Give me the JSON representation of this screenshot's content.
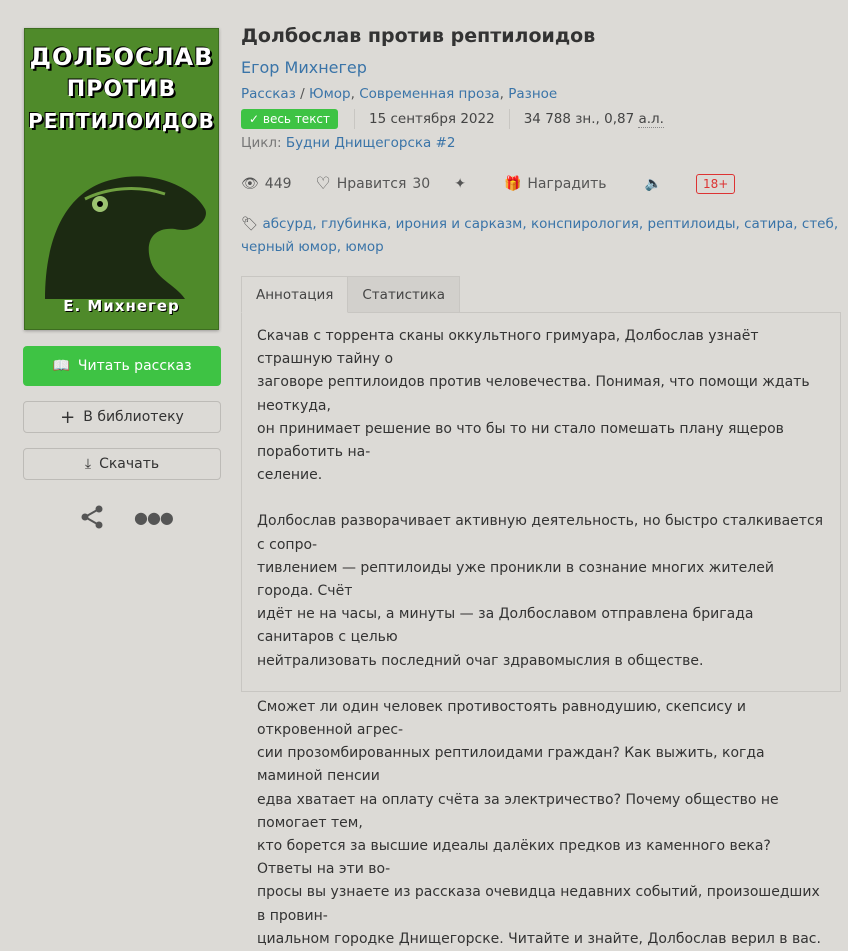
{
  "cover": {
    "title_lines": [
      "ДОЛБОСЛАВ",
      "ПРОТИВ",
      "РЕПТИЛОИДОВ"
    ],
    "author": "Е. Михнегер"
  },
  "sidebar": {
    "read_label": "Читать рассказ",
    "library_label": "В библиотеку",
    "download_label": "Скачать"
  },
  "book": {
    "title": "Долбослав против рептилоидов",
    "author": "Егор Михнегер",
    "genres": [
      {
        "label": "Рассказ"
      },
      {
        "label": "Юмор"
      },
      {
        "label": "Современная проза"
      },
      {
        "label": "Разное"
      }
    ],
    "badge": "весь текст",
    "date": "15 сентября 2022",
    "size": "34 788 зн., 0,87",
    "size_unit": "а.л.",
    "cycle_label": "Цикл:",
    "cycle": "Будни Днищегорска #2"
  },
  "stats": {
    "views": "449",
    "likes_label": "Нравится",
    "likes": "30",
    "reward_label": "Наградить",
    "age": "18+"
  },
  "tags": [
    "абсурд",
    "глубинка",
    "ирония и сарказм",
    "конспирология",
    "рептилоиды",
    "сатира",
    "стеб",
    "черный юмор",
    "юмор"
  ],
  "tabs": [
    "Аннотация",
    "Статистика"
  ],
  "annotation": [
    [
      "Скачав с торрента сканы оккультного гримуара, Долбослав узнаёт страшную тайну о",
      "заговоре рептилоидов против человечества. Понимая, что помощи ждать неоткуда,",
      "он принимает решение во что бы то ни стало помешать плану ящеров поработить на-",
      "селение."
    ],
    [
      "Долбослав разворачивает активную деятельность, но быстро сталкивается с сопро-",
      "тивлением — рептилоиды уже проникли в сознание многих жителей города. Счёт",
      "идёт не на часы, а минуты — за Долбославом отправлена бригада санитаров с целью",
      "нейтрализовать последний очаг здравомыслия в обществе."
    ],
    [
      "Сможет ли один человек противостоять равнодушию, скепсису и откровенной агрес-",
      "сии прозомбированных рептилоидами граждан? Как выжить, когда маминой пенсии",
      "едва хватает на оплату счёта за электричество? Почему общество не помогает тем,",
      "кто борется за высшие идеалы далёких предков из каменного века? Ответы на эти во-",
      "просы вы узнаете из рассказа очевидца недавних событий, произошедших в провин-",
      "циальном городке Днищегорске. Читайте и знайте, Долбослав верил в вас."
    ]
  ]
}
